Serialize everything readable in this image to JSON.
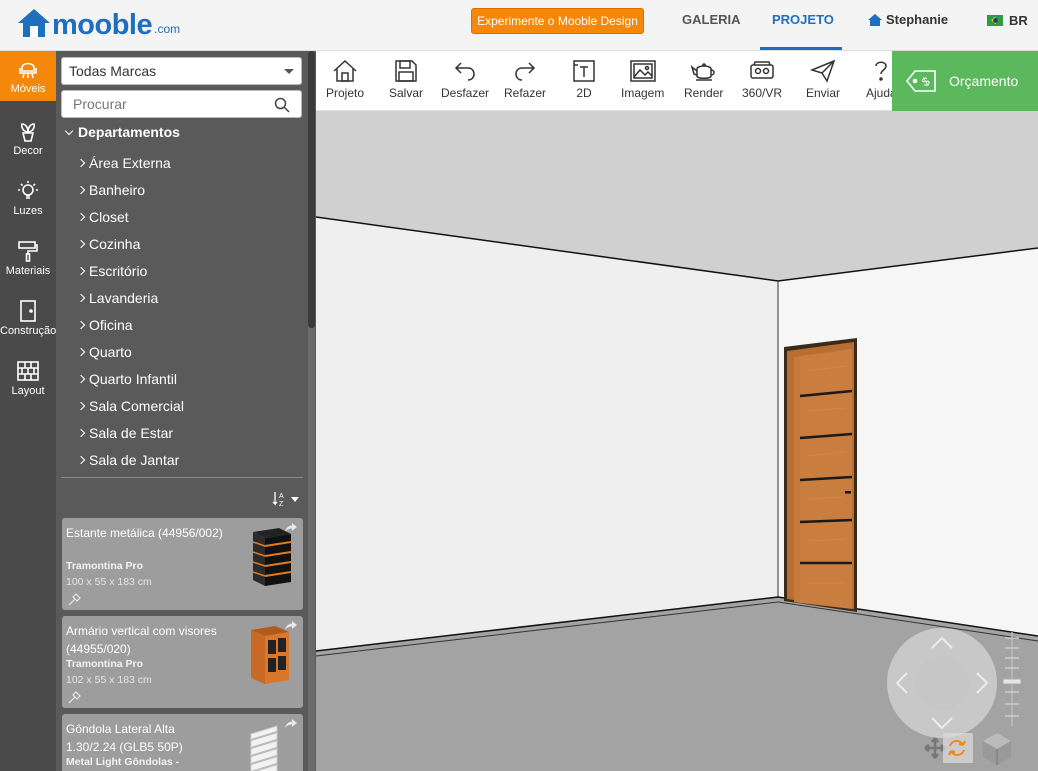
{
  "header": {
    "logo_text": "mooble",
    "logo_suffix": ".com",
    "cta_label": "Experimente o Mooble Design",
    "nav": [
      {
        "label": "GALERIA",
        "active": false
      },
      {
        "label": "PROJETO",
        "active": true
      }
    ],
    "user_name": "Stephanie",
    "language": "BR",
    "accent_color": "#1f6fbf",
    "cta_color": "#f5870b"
  },
  "rail": {
    "items": [
      {
        "label": "Móveis",
        "icon": "chair-icon",
        "active": true
      },
      {
        "label": "Decor",
        "icon": "plant-icon",
        "active": false
      },
      {
        "label": "Luzes",
        "icon": "bulb-icon",
        "active": false
      },
      {
        "label": "Materiais",
        "icon": "paint-roller-icon",
        "active": false
      },
      {
        "label": "Construção",
        "icon": "door-icon",
        "active": false
      },
      {
        "label": "Layout",
        "icon": "brick-wall-icon",
        "active": false
      }
    ]
  },
  "catalog": {
    "brand_select": "Todas Marcas",
    "search_placeholder": "Procurar",
    "departments_title": "Departamentos",
    "departments": [
      "Área Externa",
      "Banheiro",
      "Closet",
      "Cozinha",
      "Escritório",
      "Lavanderia",
      "Oficina",
      "Quarto",
      "Quarto Infantil",
      "Sala Comercial",
      "Sala de Estar",
      "Sala de Jantar"
    ],
    "sort_icon": "sort-az-icon",
    "products": [
      {
        "name": "Estante metálica (44956/002)",
        "brand": "Tramontina Pro",
        "dims": "100 x 55 x 183 cm"
      },
      {
        "name": "Armário vertical com visores (44955/020)",
        "brand": "Tramontina Pro",
        "dims": "102 x 55 x 183 cm"
      },
      {
        "name": "Gôndola Lateral Alta 1.30/2.24 (GLB5 50P)",
        "brand": "Metal Light Gôndolas -",
        "dims": ""
      }
    ]
  },
  "toolbar": {
    "tools": [
      {
        "label": "Projeto",
        "icon": "home-icon"
      },
      {
        "label": "Salvar",
        "icon": "save-icon"
      },
      {
        "label": "Desfazer",
        "icon": "undo-icon"
      },
      {
        "label": "Refazer",
        "icon": "redo-icon"
      },
      {
        "label": "2D",
        "icon": "floorplan-2d-icon"
      },
      {
        "label": "Imagem",
        "icon": "image-icon"
      },
      {
        "label": "Render",
        "icon": "teapot-icon"
      },
      {
        "label": "360/VR",
        "icon": "vr-headset-icon"
      },
      {
        "label": "Enviar",
        "icon": "send-icon"
      },
      {
        "label": "Ajuda",
        "icon": "help-icon"
      }
    ],
    "quote_label": "Orçamento",
    "quote_color": "#5cb85c"
  }
}
